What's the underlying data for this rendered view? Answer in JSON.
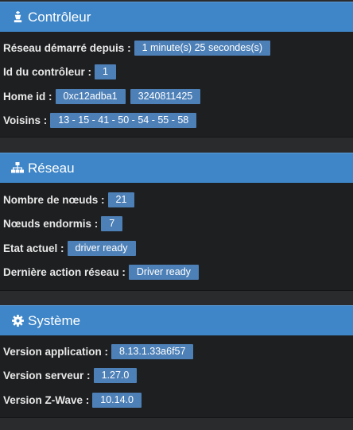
{
  "controller": {
    "title": "Contrôleur",
    "rows": [
      {
        "label": "Réseau démarré depuis :",
        "values": [
          "1 minute(s) 25 secondes(s)"
        ]
      },
      {
        "label": "Id du contrôleur :",
        "values": [
          "1"
        ]
      },
      {
        "label": "Home id :",
        "values": [
          "0xc12adba1",
          "3240811425"
        ]
      },
      {
        "label": "Voisins :",
        "values": [
          "13 - 15 - 41 - 50 - 54 - 55 - 58"
        ]
      }
    ]
  },
  "network": {
    "title": "Réseau",
    "rows": [
      {
        "label": "Nombre de nœuds :",
        "values": [
          "21"
        ]
      },
      {
        "label": "Nœuds endormis :",
        "values": [
          "7"
        ]
      },
      {
        "label": "Etat actuel :",
        "values": [
          "driver ready"
        ]
      },
      {
        "label": "Dernière action réseau :",
        "values": [
          "Driver ready"
        ]
      }
    ]
  },
  "system": {
    "title": "Système",
    "rows": [
      {
        "label": "Version application :",
        "values": [
          "8.13.1.33a6f57"
        ]
      },
      {
        "label": "Version serveur :",
        "values": [
          "1.27.0"
        ]
      },
      {
        "label": "Version Z-Wave :",
        "values": [
          "10.14.0"
        ]
      }
    ]
  },
  "icons": {
    "controller": "chess-king-icon",
    "network": "sitemap-icon",
    "system": "cog-icon"
  },
  "colors": {
    "header": "#3f86c8",
    "badge": "#4d80b7",
    "background": "#2a2b2d",
    "panel": "#1e1f21"
  }
}
